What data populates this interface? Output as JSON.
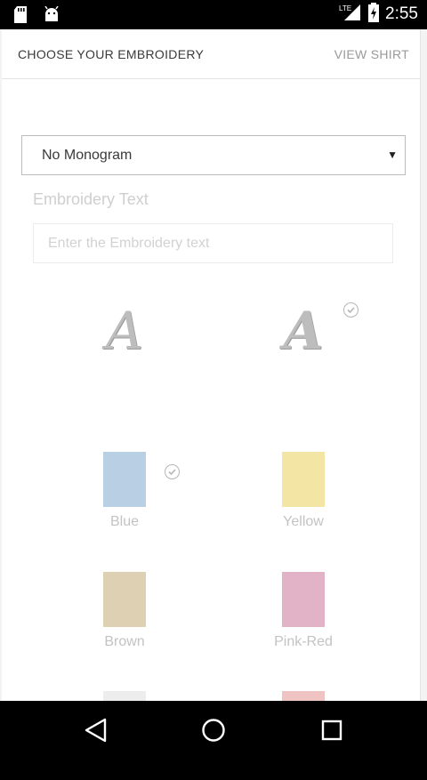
{
  "status_bar": {
    "time": "2:55",
    "network": "LTE",
    "icons": [
      "sd-card-icon",
      "android-icon",
      "lte-signal-icon",
      "battery-icon"
    ]
  },
  "header": {
    "title": "CHOOSE YOUR EMBROIDERY",
    "action": "VIEW SHIRT"
  },
  "monogram_select": {
    "value": "No Monogram"
  },
  "embroidery": {
    "label": "Embroidery Text",
    "placeholder": "Enter the Embroidery text",
    "value": ""
  },
  "font_options": [
    {
      "glyph": "A",
      "selected": false
    },
    {
      "glyph": "A",
      "selected": true
    }
  ],
  "thread_colors": [
    {
      "name": "Blue",
      "color": "#b9cfe3",
      "selected": true
    },
    {
      "name": "Yellow",
      "color": "#f3e6a4",
      "selected": false
    },
    {
      "name": "Brown",
      "color": "#ddd0b3",
      "selected": false
    },
    {
      "name": "Pink-Red",
      "color": "#e2b3c7",
      "selected": false
    },
    {
      "name": "",
      "color": "#ededed",
      "selected": false
    },
    {
      "name": "",
      "color": "#f0c3c3",
      "selected": false
    }
  ],
  "colors": {
    "title": "#3a3a3a",
    "muted": "#9a9a9a",
    "check": "#b5b5b5"
  },
  "nav_bar": {
    "buttons": [
      "back-icon",
      "home-icon",
      "recents-icon"
    ]
  }
}
